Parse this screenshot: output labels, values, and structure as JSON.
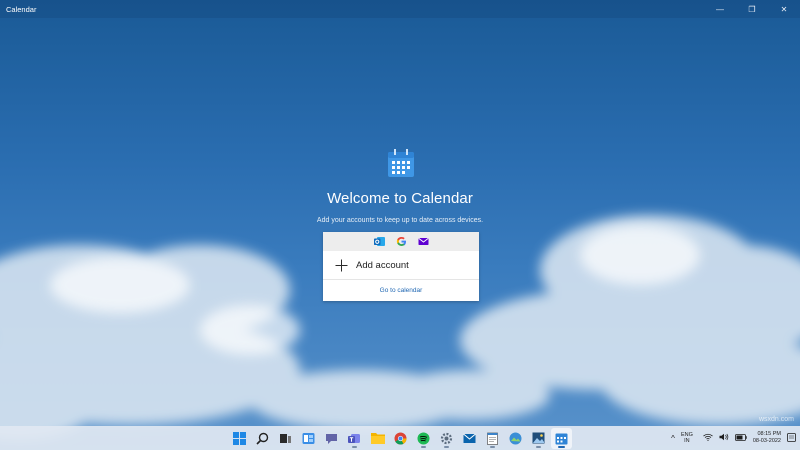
{
  "window": {
    "title": "Calendar",
    "controls": [
      {
        "name": "minimize-button",
        "glyph": "—"
      },
      {
        "name": "maximize-button",
        "glyph": "❐"
      },
      {
        "name": "close-button",
        "glyph": "✕"
      }
    ]
  },
  "welcome": {
    "heading": "Welcome to Calendar",
    "subtitle": "Add your accounts to keep up to date across devices.",
    "providers": [
      "outlook-icon",
      "google-icon",
      "yahoo-mail-icon"
    ],
    "add_account_label": "Add account",
    "goto_calendar_label": "Go to calendar"
  },
  "taskbar": {
    "apps": [
      "windows-start-icon",
      "search-icon",
      "task-view-icon",
      "widgets-icon",
      "chat-icon",
      "teams-icon",
      "file-explorer-icon",
      "chrome-icon",
      "spotify-icon",
      "settings-icon",
      "mail-icon",
      "notepad-icon",
      "photos-icon",
      "image-viewer-icon",
      "calendar-icon"
    ],
    "tray": {
      "chevron": "^",
      "lang_line1": "ENG",
      "lang_line2": "IN",
      "time": "08:15 PM",
      "date": "08-03-2022"
    }
  },
  "watermark": "wsxdn.com",
  "colors": {
    "accent": "#1f67b3",
    "calendar_icon": "#3f97e6",
    "outlook": "#0f6cbd",
    "yahoo": "#5f01d1"
  }
}
